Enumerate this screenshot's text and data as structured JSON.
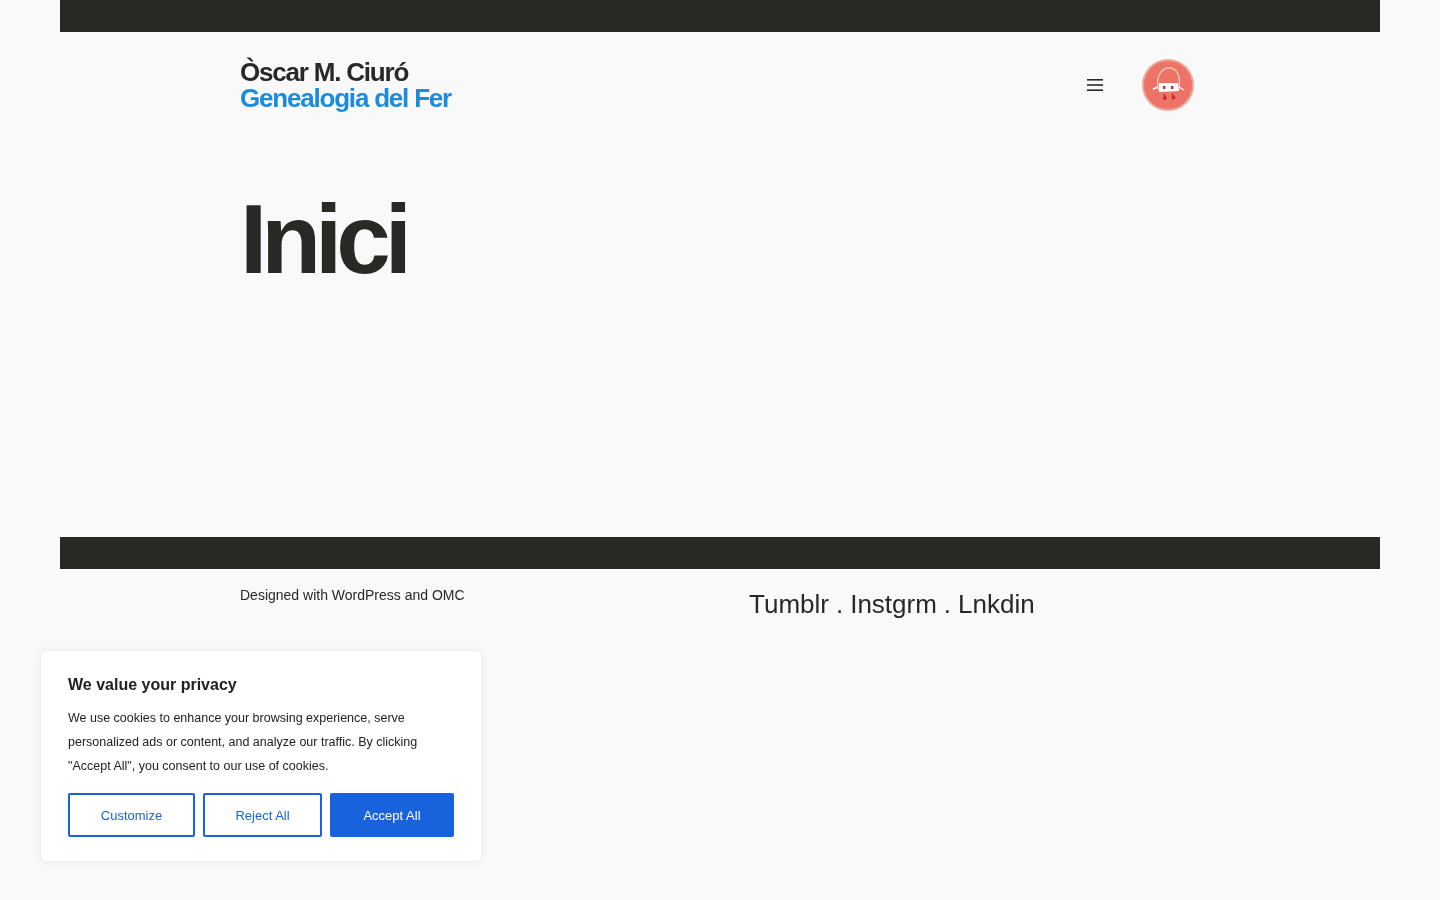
{
  "header": {
    "site_title": "Òscar M. Ciuró",
    "site_subtitle": "Genealogia del Fer"
  },
  "page": {
    "title": "Inici"
  },
  "footer": {
    "credit": "Designed with WordPress and OMC",
    "social_links": [
      "Tumblr",
      "Instgrm",
      "Lnkdin"
    ],
    "separator": "."
  },
  "cookie_banner": {
    "title": "We value your privacy",
    "text": "We use cookies to enhance your browsing experience, serve personalized ads or content, and analyze our traffic. By clicking \"Accept All\", you consent to our use of cookies.",
    "buttons": [
      {
        "label": "Customize",
        "kind": "outline"
      },
      {
        "label": "Reject All",
        "kind": "outline"
      },
      {
        "label": "Accept All",
        "kind": "primary"
      }
    ]
  }
}
